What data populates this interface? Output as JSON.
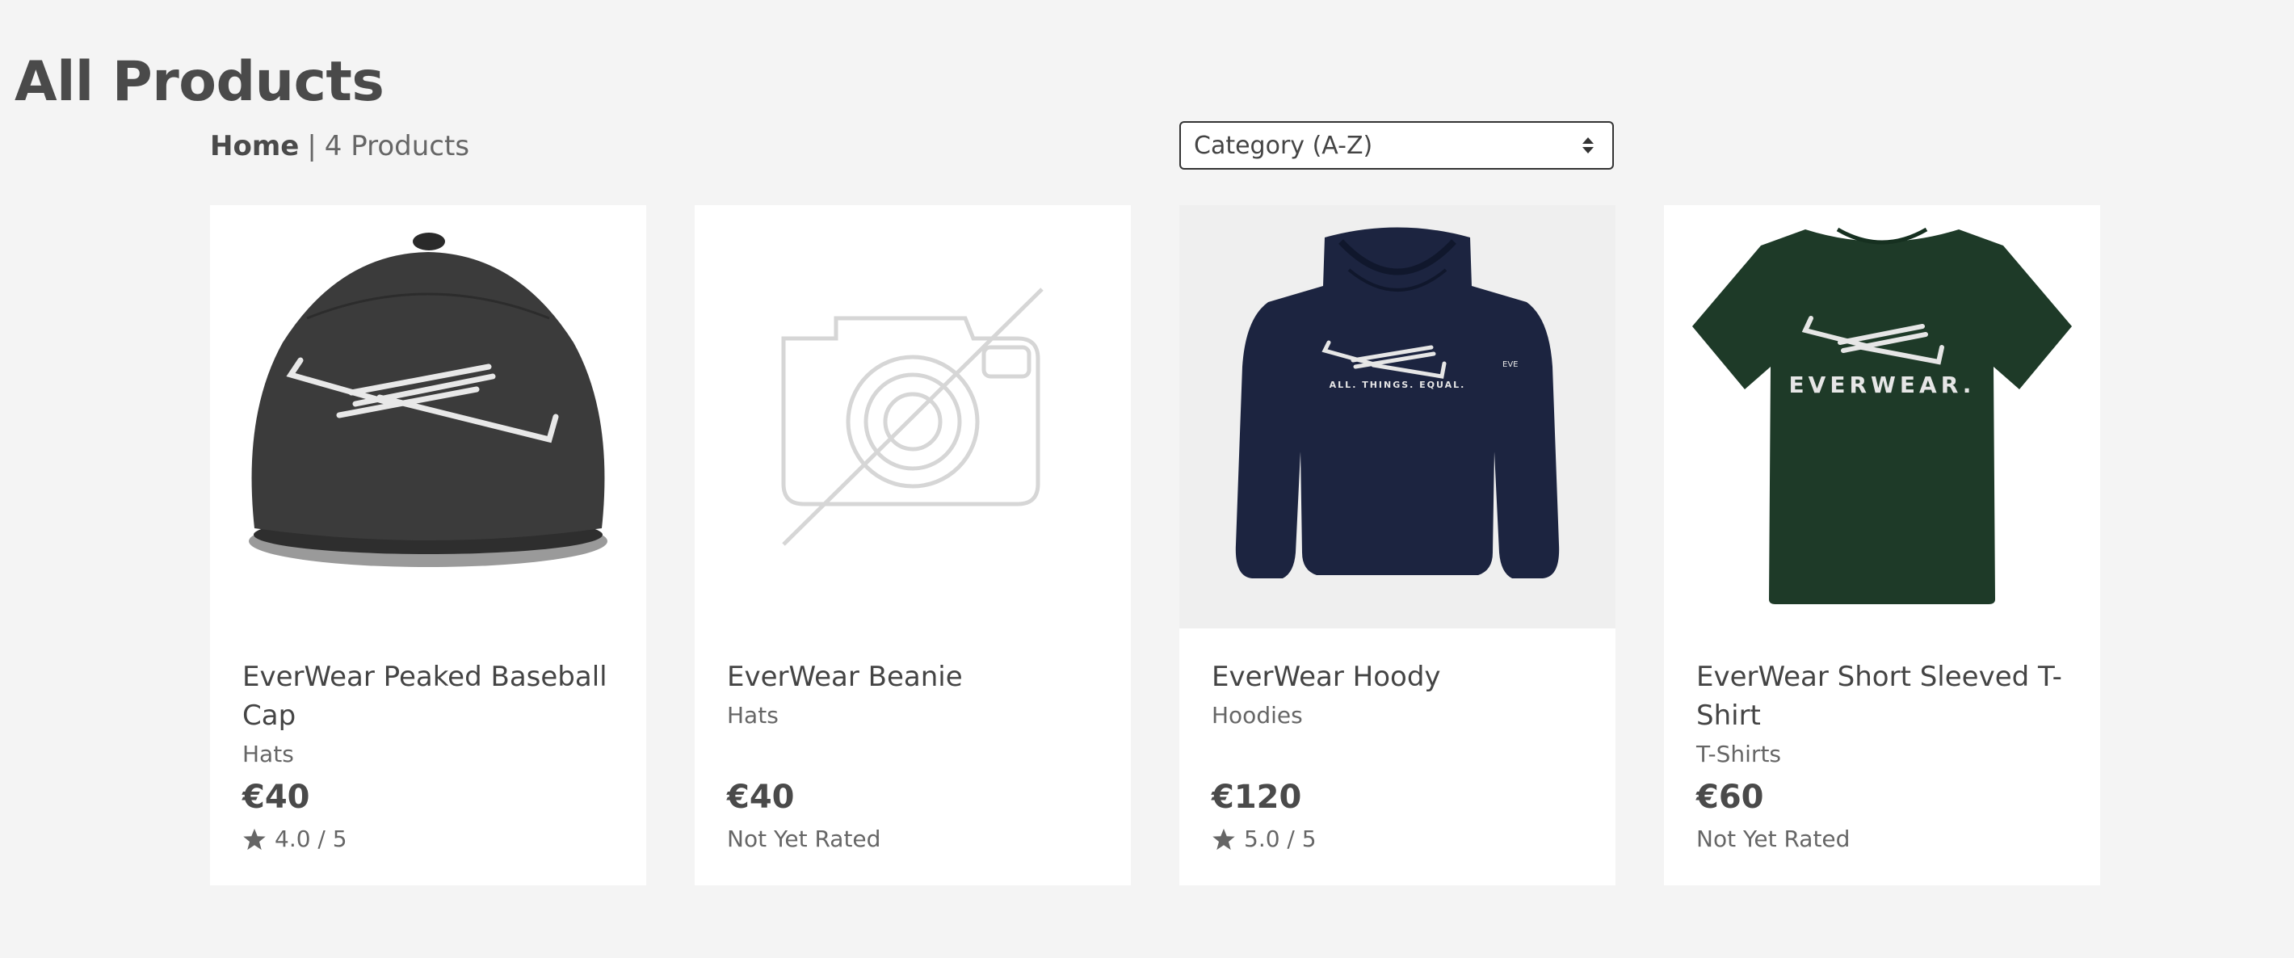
{
  "page": {
    "title": "All Products"
  },
  "breadcrumb": {
    "home": "Home",
    "separator": "|",
    "count": "4 Products"
  },
  "sort": {
    "selected": "Category (A-Z)"
  },
  "products": [
    {
      "name": "EverWear Peaked Baseball Cap",
      "category": "Hats",
      "price": "€40",
      "rating": "4.0 / 5",
      "image": "baseball-cap"
    },
    {
      "name": "EverWear Beanie",
      "category": "Hats",
      "price": "€40",
      "rating": "Not Yet Rated",
      "image": "no-image-placeholder"
    },
    {
      "name": "EverWear Hoody",
      "category": "Hoodies",
      "price": "€120",
      "rating": "5.0 / 5",
      "image": "hoody"
    },
    {
      "name": "EverWear Short Sleeved T-Shirt",
      "category": "T-Shirts",
      "price": "€60",
      "rating": "Not Yet Rated",
      "image": "t-shirt"
    }
  ],
  "artwork": {
    "hoody_print": "ALL. THINGS. EQUAL.",
    "tshirt_print": "EVERWEAR.",
    "sleeve_print": "EVE"
  },
  "colors": {
    "background": "#f4f4f4",
    "cap": "#3a3a3a",
    "hoody": "#1c2440",
    "tshirt": "#1e3a28",
    "star": "#666666"
  }
}
